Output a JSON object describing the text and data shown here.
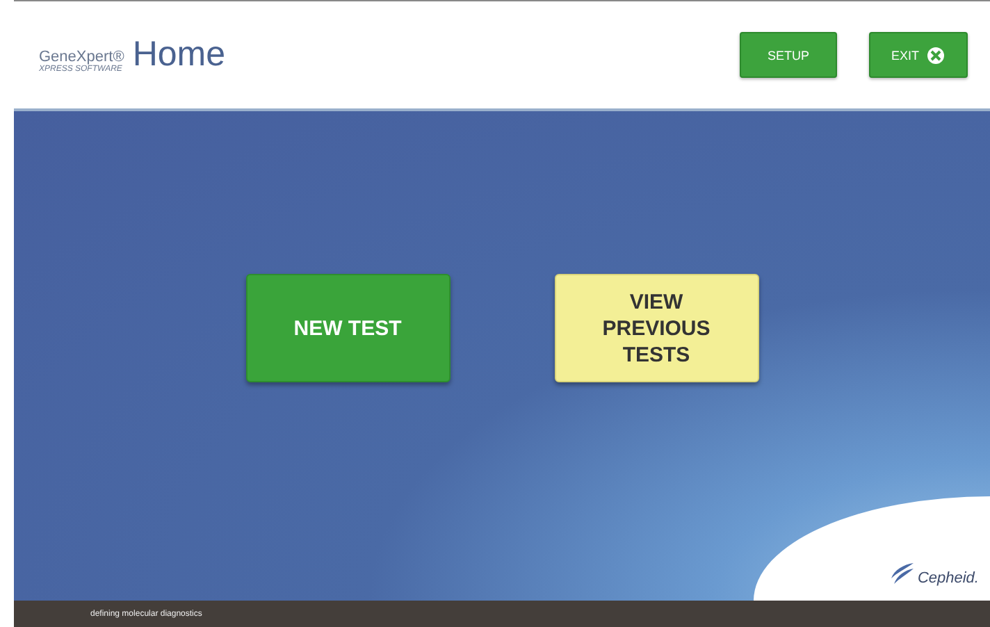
{
  "header": {
    "brand": "GeneXpert®",
    "brand_sub": "XPRESS SOFTWARE",
    "title": "Home",
    "buttons": [
      {
        "kind": "setup",
        "label": "SETUP"
      },
      {
        "kind": "exit",
        "label": "EXIT"
      }
    ]
  },
  "actions": [
    {
      "kind": "green",
      "label": "NEW TEST"
    },
    {
      "kind": "yellow",
      "label": "VIEW PREVIOUS TESTS"
    }
  ],
  "footer": {
    "tagline": "defining molecular diagnostics",
    "logo": "Cepheid."
  }
}
